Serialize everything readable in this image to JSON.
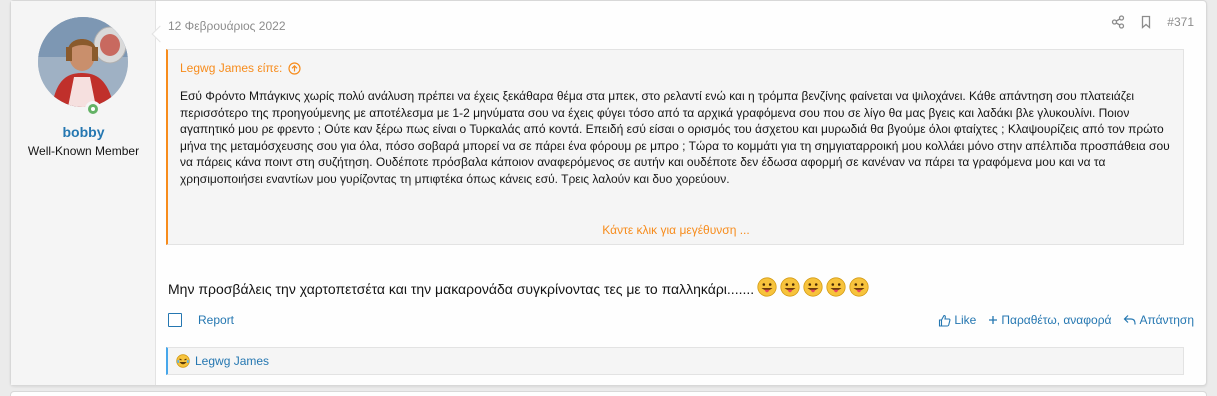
{
  "post": {
    "date": "12 Φεβρουάριος 2022",
    "number": "#371",
    "share_icon": "share-icon",
    "bookmark_icon": "bookmark-icon"
  },
  "user": {
    "name": "bobby",
    "title": "Well-Known Member",
    "online": true
  },
  "quote": {
    "author_line": "Legwg James είπε:",
    "body": "Εσύ Φρόντο Μπάγκινς χωρίς πολύ ανάλυση πρέπει να έχεις ξεκάθαρα θέμα στα μπεκ, στο ρελαντί ενώ και η τρόμπα βενζίνης φαίνεται να ψιλοχάνει. Κάθε απάντηση σου πλατειάζει περισσότερο της προηγούμενης με αποτέλεσμα με 1-2 μηνύματα σου να έχεις φύγει τόσο από τα αρχικά γραφόμενα σου που σε λίγο θα μας βγεις και λαδάκι βλε γλυκουλίνι. Ποιον αγαπητικό μου ρε φρεντο ; Ούτε καν ξέρω πως είναι ο Τυρκαλάς από κοντά. Επειδή εσύ είσαι ο ορισμός του άσχετου και μυρωδιά θα βγούμε όλοι φταίχτες ; Κλαψουρίζεις από τον πρώτο μήνα της μεταμόσχευσης σου για όλα, πόσο σοβαρά μπορεί να σε πάρει ένα φόρουμ ρε μπρο ; Τώρα το κομμάτι για τη σημγιαταρροική μου κολλάει μόνο στην απέλπιδα προσπάθεια σου να πάρεις κάνα ποιντ στη συζήτηση. Ουδέποτε πρόσβαλα κάποιον αναφερόμενος σε αυτήν και ουδέποτε δεν έδωσα αφορμή σε κανέναν να πάρει τα γραφόμενα μου και να τα χρησιμοποιήσει εναντίων μου γυρίζοντας τη μπιφτέκα όπως κάνεις εσύ. Τρεις λαλούν και δυο χορεύουν.",
    "expand": "Κάντε κλικ για μεγέθυνση ..."
  },
  "message": {
    "text": "Μην προσβάλεις την χαρτοπετσέτα και την μακαρονάδα συγκρίνοντας τες με το παλληκάρι.......",
    "emoji_icon": "tongue-out-emoji-icon",
    "emoji_count": 5
  },
  "actions": {
    "report": "Report",
    "like": "Like",
    "quote": "Παραθέτω, αναφορά",
    "reply": "Απάντηση"
  },
  "reactions": {
    "user": "Legwg James",
    "icon": "laugh-reaction-icon"
  },
  "colors": {
    "link": "#2577b1",
    "quote_accent": "#f78c1c",
    "reaction_accent": "#47a7eb",
    "online": "#63b265"
  }
}
